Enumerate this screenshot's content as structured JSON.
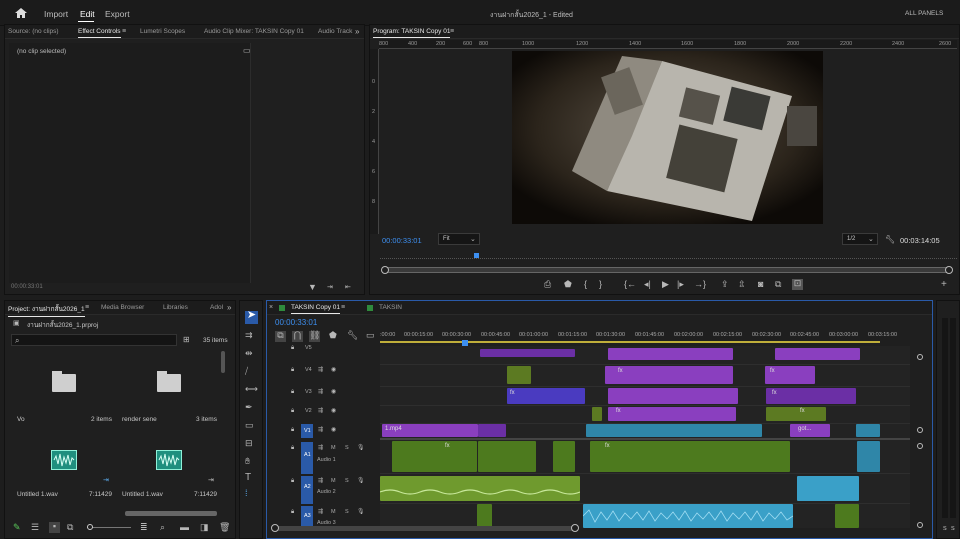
{
  "top_nav": {
    "home": "home-icon",
    "import": "Import",
    "edit": "Edit",
    "export": "Export",
    "title": "งานฝากสั้น2026_1 - Edited",
    "all_panels": "ALL PANELS"
  },
  "source_panel": {
    "tabs": [
      "Source: (no clips)",
      "Effect Controls",
      "Lumetri Scopes",
      "Audio Clip Mixer: TAKSIN Copy 01",
      "Audio Track"
    ],
    "no_clip": "(no clip selected)",
    "timecode": "00:00:33:01"
  },
  "program_panel": {
    "tab": "Program: TAKSIN Copy 01",
    "ruler_labels": [
      "800",
      "1000",
      "1200",
      "1400",
      "1600",
      "1800",
      "2000",
      "2200",
      "2400",
      "2600",
      "200",
      "400",
      "600"
    ],
    "vruler_labels": [
      "0",
      "2",
      "4",
      "6",
      "8",
      "10"
    ],
    "timecode": "00:00:33:01",
    "fit": "Fit",
    "resolution": "1/2",
    "duration": "00:03:14:05"
  },
  "project_panel": {
    "tabs": [
      "Project: งานฝากสั้น2026_1",
      "Media Browser",
      "Libraries",
      "Adol"
    ],
    "file": "งานฝากสั้น2026_1.prproj",
    "item_count": "35 items",
    "items": [
      {
        "name": "Vo",
        "meta": "2 items"
      },
      {
        "name": "render sene",
        "meta": "3 items"
      },
      {
        "name": "Untitled 1.wav",
        "meta": "7:11429"
      },
      {
        "name": "Untitled 1.wav",
        "meta": "7:11429"
      }
    ]
  },
  "timeline": {
    "tabs": [
      "TAKSIN Copy 01",
      "TAKSIN"
    ],
    "timecode": "00:00:33:01",
    "ruler": [
      ":00:00",
      "00:00:15:00",
      "00:00:30:00",
      "00:00:45:00",
      "00:01:00:00",
      "00:01:15:00",
      "00:01:30:00",
      "00:01:45:00",
      "00:02:00:00",
      "00:02:15:00",
      "00:02:30:00",
      "00:02:45:00",
      "00:03:00:00",
      "00:03:15:00"
    ],
    "tracks": [
      {
        "id": "V5",
        "label": "V5"
      },
      {
        "id": "V4",
        "label": "V4"
      },
      {
        "id": "V3",
        "label": "V3"
      },
      {
        "id": "V2",
        "label": "V2"
      },
      {
        "id": "V1",
        "label": "V1"
      },
      {
        "id": "A1",
        "label": "A1",
        "name": "Audio 1"
      },
      {
        "id": "A2",
        "label": "A2",
        "name": "Audio 2"
      },
      {
        "id": "A3",
        "label": "A3",
        "name": "Audio 3"
      }
    ],
    "clip_labels": {
      "mp4": "1.mp4",
      "fx": "fx",
      "got": "got..."
    }
  },
  "meters": {
    "labels": [
      "S",
      "S"
    ]
  },
  "colors": {
    "accent": "#3d8ff0",
    "video": "#8a3fbf",
    "audio": "#4d7a1e",
    "cyan": "#2f86a8"
  }
}
